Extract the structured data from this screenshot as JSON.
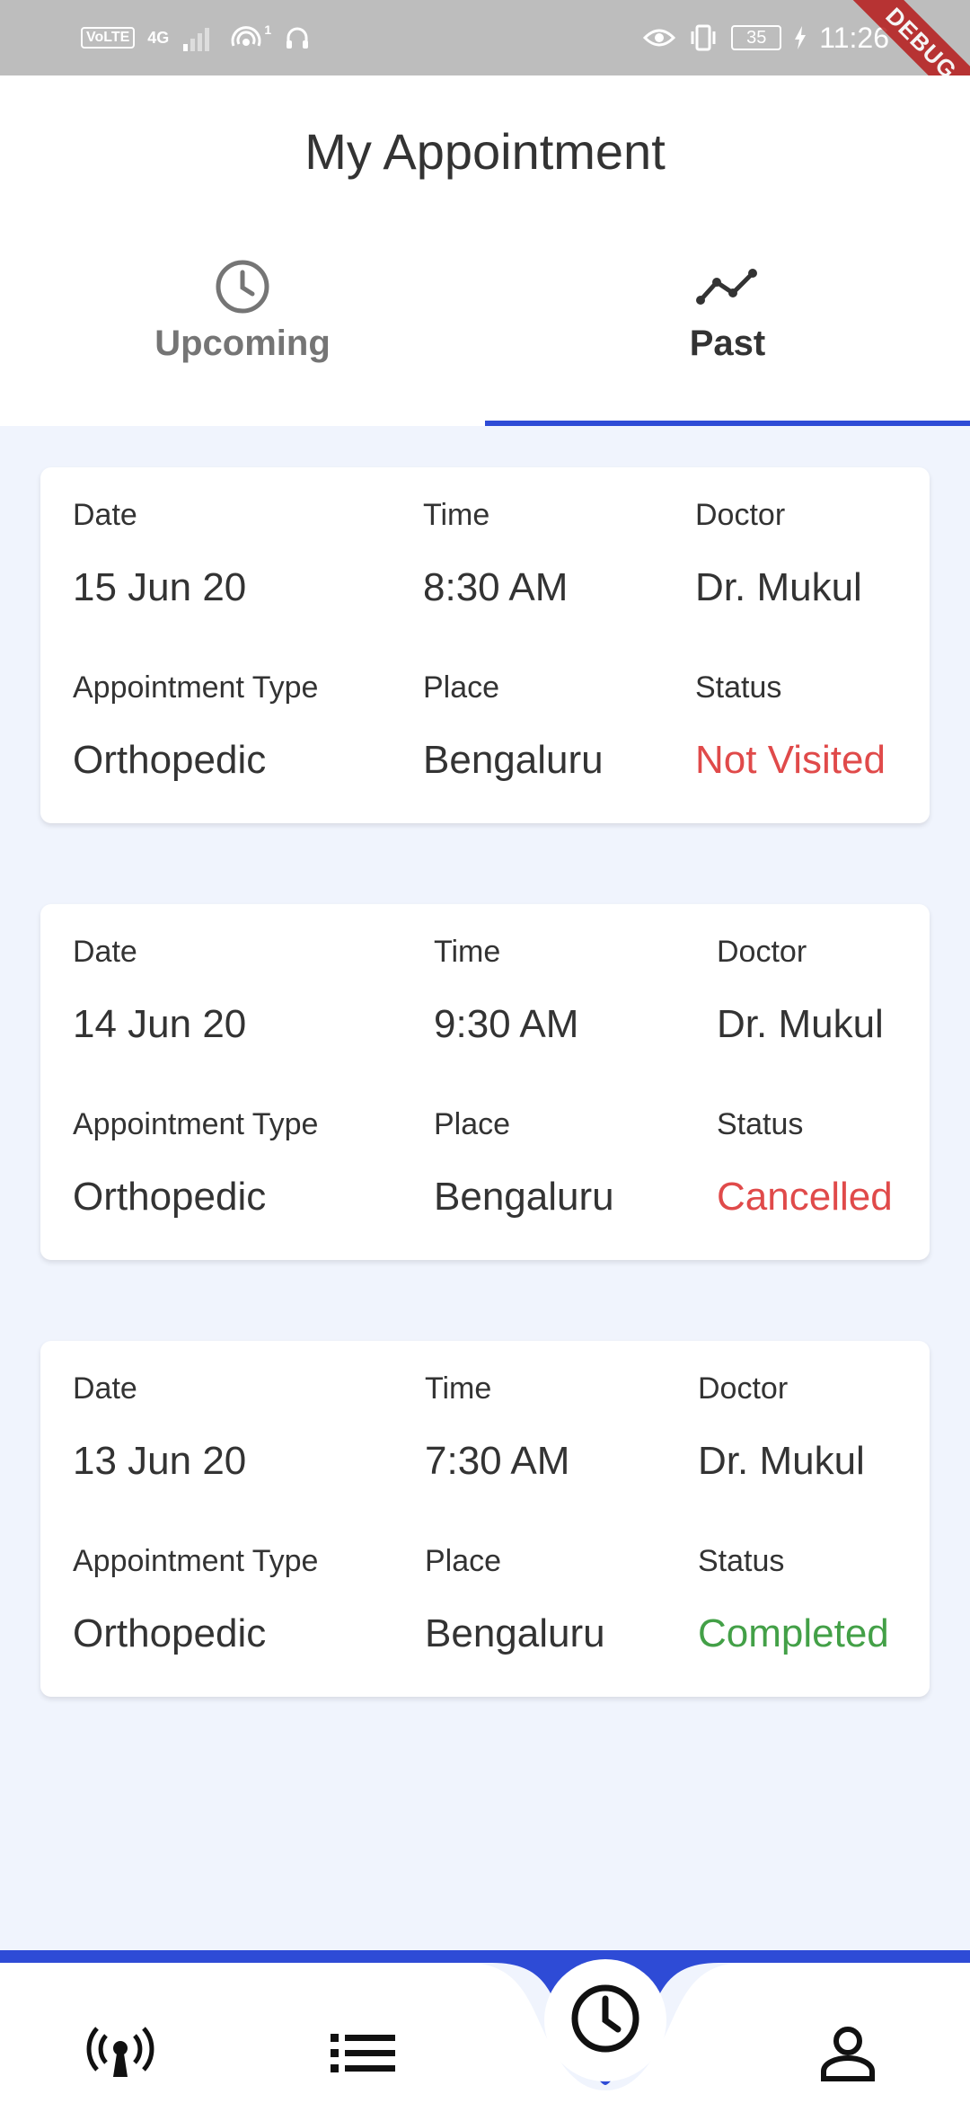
{
  "status_bar": {
    "volte": "VoLTE",
    "network": "4G",
    "hotspot_count": "1",
    "battery": "35",
    "time": "11:26"
  },
  "debug_banner": "DEBUG",
  "header": {
    "title": "My Appointment",
    "tabs": [
      {
        "label": "Upcoming",
        "icon": "clock-icon",
        "selected": false
      },
      {
        "label": "Past",
        "icon": "trend-line-icon",
        "selected": true
      }
    ]
  },
  "labels": {
    "date": "Date",
    "time": "Time",
    "doctor": "Doctor",
    "appointment_type": "Appointment Type",
    "place": "Place",
    "status": "Status"
  },
  "appointments": [
    {
      "date": "15 Jun 20",
      "time": "8:30 AM",
      "doctor": "Dr. Mukul",
      "type": "Orthopedic",
      "place": "Bengaluru",
      "status": "Not Visited",
      "status_color": "#e04a4a"
    },
    {
      "date": "14 Jun 20",
      "time": "9:30 AM",
      "doctor": "Dr. Mukul",
      "type": "Orthopedic",
      "place": "Bengaluru",
      "status": "Cancelled",
      "status_color": "#e04a4a"
    },
    {
      "date": "13 Jun 20",
      "time": "7:30 AM",
      "doctor": "Dr. Mukul",
      "type": "Orthopedic",
      "place": "Bengaluru",
      "status": "Completed",
      "status_color": "#43a047"
    }
  ],
  "bottom_nav": {
    "items": [
      {
        "icon": "broadcast-icon"
      },
      {
        "icon": "list-icon"
      },
      {
        "icon": "clock-icon",
        "selected": true
      },
      {
        "icon": "person-icon"
      }
    ],
    "accent": "#2e4bd6"
  },
  "colors": {
    "accent": "#2e4bd6",
    "background": "#f0f4fd",
    "status_red": "#e04a4a",
    "status_green": "#43a047"
  }
}
